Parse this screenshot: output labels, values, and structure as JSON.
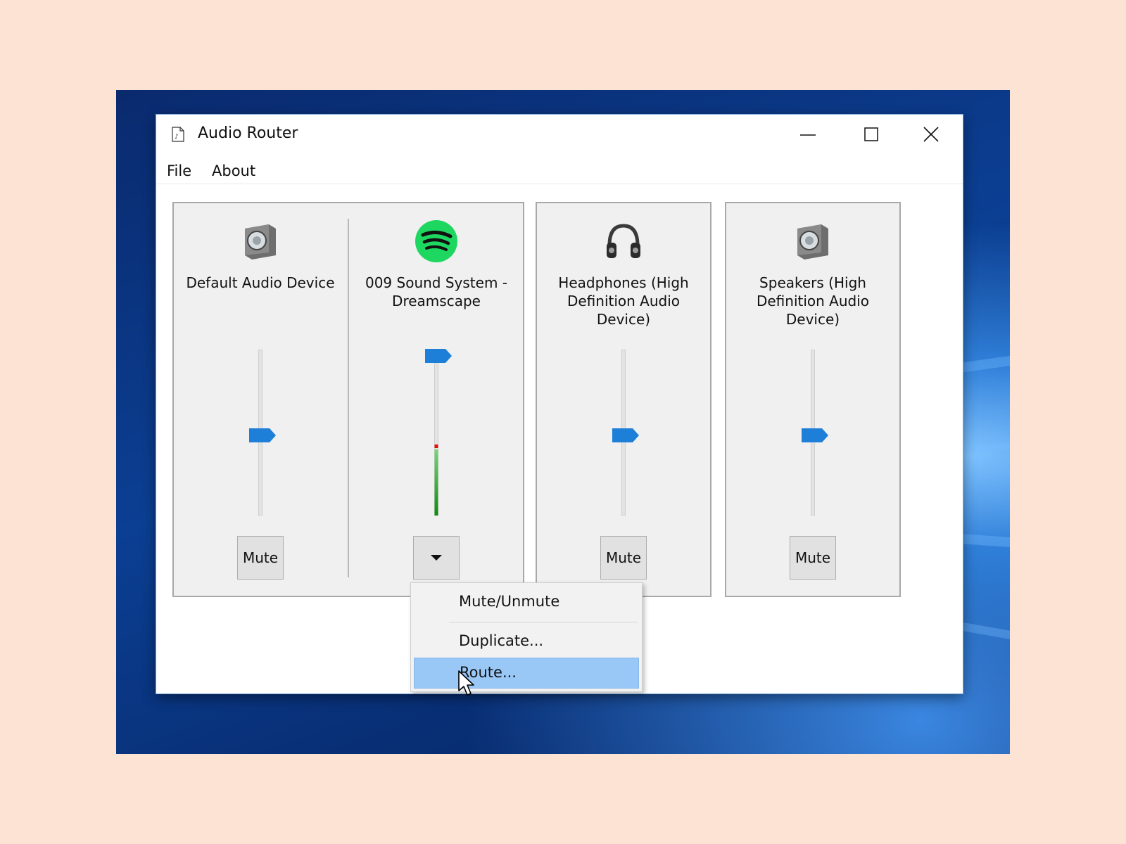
{
  "window": {
    "title": "Audio Router",
    "icon": "document-audio-icon"
  },
  "menu": {
    "file": "File",
    "about": "About"
  },
  "channels": [
    {
      "label": "Default Audio Device",
      "icon": "speaker-icon",
      "volume": 0.47,
      "button": "Mute"
    },
    {
      "label": "009 Sound System - Dreamscape",
      "icon": "spotify-icon",
      "volume": 1.0,
      "meter": 0.4,
      "button": "dropdown"
    },
    {
      "label": "Headphones (High Definition Audio Device)",
      "icon": "headphones-icon",
      "volume": 0.47,
      "button": "Mute"
    },
    {
      "label": "Speakers (High Definition Audio Device)",
      "icon": "speaker-icon",
      "volume": 0.47,
      "button": "Mute"
    }
  ],
  "context_menu": {
    "items": [
      {
        "label": "Mute/Unmute",
        "highlighted": false
      },
      {
        "label": "Duplicate...",
        "highlighted": false
      },
      {
        "label": "Route...",
        "highlighted": true
      }
    ]
  },
  "colors": {
    "accent": "#0078d7",
    "highlight": "#99c8f7",
    "spotify": "#1ed760"
  }
}
